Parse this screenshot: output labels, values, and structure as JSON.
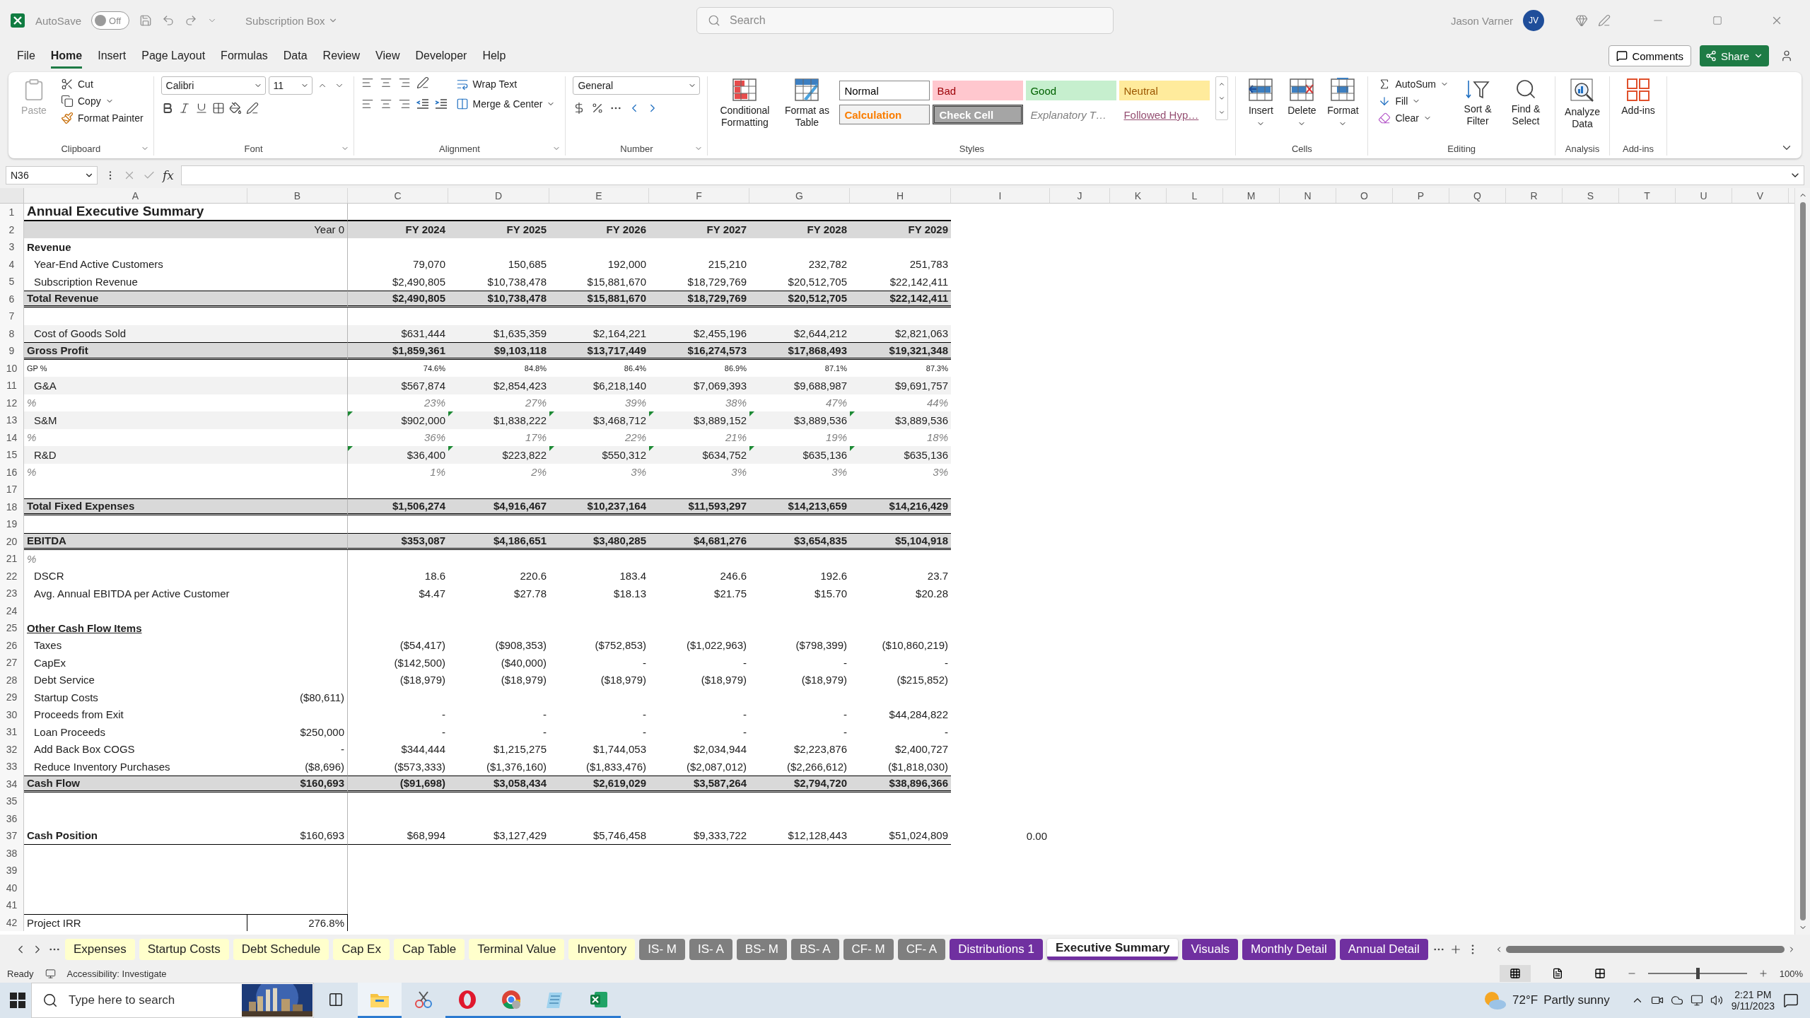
{
  "titlebar": {
    "autosave_label": "AutoSave",
    "autosave_state": "Off",
    "autosave_on": false,
    "document": "Subscription Box",
    "search_placeholder": "Search",
    "user": "Jason Varner",
    "initials": "JV"
  },
  "menu": [
    {
      "label": "File",
      "selected": false
    },
    {
      "label": "Home",
      "selected": true
    },
    {
      "label": "Insert",
      "selected": false
    },
    {
      "label": "Page Layout",
      "selected": false
    },
    {
      "label": "Formulas",
      "selected": false
    },
    {
      "label": "Data",
      "selected": false
    },
    {
      "label": "Review",
      "selected": false
    },
    {
      "label": "View",
      "selected": false
    },
    {
      "label": "Developer",
      "selected": false
    },
    {
      "label": "Help",
      "selected": false
    }
  ],
  "actions": {
    "comments": "Comments",
    "share": "Share"
  },
  "ribbon": {
    "clipboard": {
      "label": "Clipboard",
      "paste": "Paste",
      "paste_disabled": true,
      "cut": "Cut",
      "copy": "Copy",
      "painter": "Format Painter"
    },
    "font": {
      "label": "Font",
      "name": "Calibri",
      "size": "11"
    },
    "alignment": {
      "label": "Alignment",
      "wrap": "Wrap Text",
      "merge": "Merge & Center"
    },
    "number": {
      "label": "Number",
      "format": "General"
    },
    "styles": {
      "label": "Styles",
      "conditional": "Conditional Formatting",
      "table": "Format as Table",
      "cells": [
        {
          "name": "Normal",
          "kind": "normal"
        },
        {
          "name": "Bad",
          "kind": "bad"
        },
        {
          "name": "Good",
          "kind": "good"
        },
        {
          "name": "Neutral",
          "kind": "neutral"
        },
        {
          "name": "Calculation",
          "kind": "calculation"
        },
        {
          "name": "Check Cell",
          "kind": "check"
        },
        {
          "name": "Explanatory T…",
          "kind": "explanatory"
        },
        {
          "name": "Followed Hyp…",
          "kind": "hyperlink"
        }
      ]
    },
    "cells": {
      "label": "Cells",
      "buttons": [
        {
          "label": "Insert",
          "kind": "insert"
        },
        {
          "label": "Delete",
          "kind": "delete"
        },
        {
          "label": "Format",
          "kind": "format"
        }
      ]
    },
    "editing": {
      "label": "Editing",
      "autosum": "AutoSum",
      "fill": "Fill",
      "clear": "Clear",
      "sort": "Sort & Filter",
      "find": "Find & Select"
    },
    "analysis": {
      "label": "Analysis",
      "analyze": "Analyze Data"
    },
    "addins": {
      "label": "Add-ins",
      "button": "Add-ins"
    }
  },
  "formula_bar": {
    "name_box": "N36",
    "function_label": "fx"
  },
  "columns": [
    "A",
    "B",
    "C",
    "D",
    "E",
    "F",
    "G",
    "H",
    "I",
    "J",
    "K",
    "L",
    "M",
    "N",
    "O",
    "P",
    "Q",
    "R",
    "S",
    "T",
    "U",
    "V"
  ],
  "rows": [
    {
      "n": "1",
      "kind": "title",
      "label": "Annual Executive Summary"
    },
    {
      "n": "2",
      "kind": "header",
      "b": "Year 0",
      "values": [
        "FY 2024",
        "FY 2025",
        "FY 2026",
        "FY 2027",
        "FY 2028",
        "FY 2029"
      ]
    },
    {
      "n": "3",
      "kind": "section",
      "label": "Revenue"
    },
    {
      "n": "4",
      "kind": "item",
      "label": "Year-End Active Customers",
      "values": [
        "79,070",
        "150,685",
        "192,000",
        "215,210",
        "232,782",
        "251,783"
      ]
    },
    {
      "n": "5",
      "kind": "item",
      "label": "Subscription Revenue",
      "values": [
        "$2,490,805",
        "$10,738,478",
        "$15,881,670",
        "$18,729,769",
        "$20,512,705",
        "$22,142,411"
      ]
    },
    {
      "n": "6",
      "kind": "total",
      "label": "Total Revenue",
      "values": [
        "$2,490,805",
        "$10,738,478",
        "$15,881,670",
        "$18,729,769",
        "$20,512,705",
        "$22,142,411"
      ]
    },
    {
      "n": "7",
      "kind": "blank"
    },
    {
      "n": "8",
      "kind": "item",
      "shaded": true,
      "label": "Cost of Goods Sold",
      "values": [
        "$631,444",
        "$1,635,359",
        "$2,164,221",
        "$2,455,196",
        "$2,644,212",
        "$2,821,063"
      ]
    },
    {
      "n": "9",
      "kind": "total",
      "label": "Gross Profit",
      "values": [
        "$1,859,361",
        "$9,103,118",
        "$13,717,449",
        "$16,274,573",
        "$17,868,493",
        "$19,321,348"
      ]
    },
    {
      "n": "10",
      "kind": "small",
      "label": "GP %",
      "values": [
        "74.6%",
        "84.8%",
        "86.4%",
        "86.9%",
        "87.1%",
        "87.3%"
      ]
    },
    {
      "n": "11",
      "kind": "item",
      "shaded": true,
      "label": "G&A",
      "values": [
        "$567,874",
        "$2,854,423",
        "$6,218,140",
        "$7,069,393",
        "$9,688,987",
        "$9,691,757"
      ]
    },
    {
      "n": "12",
      "kind": "pct",
      "label": "%",
      "values": [
        "23%",
        "27%",
        "39%",
        "38%",
        "47%",
        "44%"
      ]
    },
    {
      "n": "13",
      "kind": "item",
      "shaded": true,
      "flagged": true,
      "label": "S&M",
      "values": [
        "$902,000",
        "$1,838,222",
        "$3,468,712",
        "$3,889,152",
        "$3,889,536",
        "$3,889,536"
      ]
    },
    {
      "n": "14",
      "kind": "pct",
      "label": "%",
      "values": [
        "36%",
        "17%",
        "22%",
        "21%",
        "19%",
        "18%"
      ]
    },
    {
      "n": "15",
      "kind": "item",
      "shaded": true,
      "flagged": true,
      "label": "R&D",
      "values": [
        "$36,400",
        "$223,822",
        "$550,312",
        "$634,752",
        "$635,136",
        "$635,136"
      ]
    },
    {
      "n": "16",
      "kind": "pct",
      "label": "%",
      "values": [
        "1%",
        "2%",
        "3%",
        "3%",
        "3%",
        "3%"
      ]
    },
    {
      "n": "17",
      "kind": "blank"
    },
    {
      "n": "18",
      "kind": "total",
      "label": "Total Fixed Expenses",
      "values": [
        "$1,506,274",
        "$4,916,467",
        "$10,237,164",
        "$11,593,297",
        "$14,213,659",
        "$14,216,429"
      ]
    },
    {
      "n": "19",
      "kind": "blank"
    },
    {
      "n": "20",
      "kind": "total",
      "label": "EBITDA",
      "values": [
        "$353,087",
        "$4,186,651",
        "$3,480,285",
        "$4,681,276",
        "$3,654,835",
        "$5,104,918"
      ]
    },
    {
      "n": "21",
      "kind": "pct",
      "label": "%"
    },
    {
      "n": "22",
      "kind": "item",
      "label": "DSCR",
      "values": [
        "18.6",
        "220.6",
        "183.4",
        "246.6",
        "192.6",
        "23.7"
      ]
    },
    {
      "n": "23",
      "kind": "item",
      "label": "Avg. Annual EBITDA per Active Customer",
      "values": [
        "$4.47",
        "$27.78",
        "$18.13",
        "$21.75",
        "$15.70",
        "$20.28"
      ]
    },
    {
      "n": "24",
      "kind": "blank"
    },
    {
      "n": "25",
      "kind": "heading",
      "label": "Other Cash Flow Items"
    },
    {
      "n": "26",
      "kind": "item",
      "label": "Taxes",
      "values": [
        "($54,417)",
        "($908,353)",
        "($752,853)",
        "($1,022,963)",
        "($798,399)",
        "($10,860,219)"
      ]
    },
    {
      "n": "27",
      "kind": "item",
      "label": "CapEx",
      "values": [
        "($142,500)",
        "($40,000)",
        "-",
        "-",
        "-",
        "-"
      ]
    },
    {
      "n": "28",
      "kind": "item",
      "label": "Debt Service",
      "values": [
        "($18,979)",
        "($18,979)",
        "($18,979)",
        "($18,979)",
        "($18,979)",
        "($215,852)"
      ]
    },
    {
      "n": "29",
      "kind": "item",
      "label": "Startup Costs",
      "b": "($80,611)"
    },
    {
      "n": "30",
      "kind": "item",
      "label": "Proceeds from Exit",
      "values": [
        "-",
        "-",
        "-",
        "-",
        "-",
        "$44,284,822"
      ]
    },
    {
      "n": "31",
      "kind": "item",
      "label": "Loan Proceeds",
      "b": "$250,000",
      "values": [
        "-",
        "-",
        "-",
        "-",
        "-",
        "-"
      ]
    },
    {
      "n": "32",
      "kind": "item",
      "label": "Add Back Box COGS",
      "b": "-",
      "values": [
        "$344,444",
        "$1,215,275",
        "$1,744,053",
        "$2,034,944",
        "$2,223,876",
        "$2,400,727"
      ]
    },
    {
      "n": "33",
      "kind": "item",
      "label": "Reduce Inventory Purchases",
      "b": "($8,696)",
      "values": [
        "($573,333)",
        "($1,376,160)",
        "($1,833,476)",
        "($2,087,012)",
        "($2,266,612)",
        "($1,818,030)"
      ]
    },
    {
      "n": "34",
      "kind": "total",
      "label": "Cash Flow",
      "b": "$160,693",
      "values": [
        "($91,698)",
        "$3,058,434",
        "$2,619,029",
        "$3,587,264",
        "$2,794,720",
        "$38,896,366"
      ]
    },
    {
      "n": "35",
      "kind": "blank"
    },
    {
      "n": "36",
      "kind": "blank"
    },
    {
      "n": "37",
      "kind": "position",
      "label": "Cash Position",
      "b": "$160,693",
      "values": [
        "$68,994",
        "$3,127,429",
        "$5,746,458",
        "$9,333,722",
        "$12,128,443",
        "$51,024,809",
        "0.00"
      ]
    },
    {
      "n": "38",
      "kind": "blank"
    },
    {
      "n": "39",
      "kind": "blank"
    },
    {
      "n": "40",
      "kind": "blank"
    },
    {
      "n": "41",
      "kind": "blank"
    },
    {
      "n": "42",
      "kind": "irr",
      "label": "Project IRR",
      "b": "276.8%"
    }
  ],
  "sheet_tabs": [
    {
      "label": "Expenses",
      "color": "#ffffcc",
      "selected": false
    },
    {
      "label": "Startup Costs",
      "color": "#ffffcc",
      "selected": false
    },
    {
      "label": "Debt Schedule",
      "color": "#ffffcc",
      "selected": false
    },
    {
      "label": "Cap Ex",
      "color": "#ffffcc",
      "selected": false
    },
    {
      "label": "Cap Table",
      "color": "#ffffcc",
      "selected": false
    },
    {
      "label": "Terminal Value",
      "color": "#ffffcc",
      "selected": false
    },
    {
      "label": "Inventory",
      "color": "#ffffcc",
      "selected": false
    },
    {
      "label": "IS- M",
      "color": "#7f7f7f",
      "selected": false
    },
    {
      "label": "IS- A",
      "color": "#7f7f7f",
      "selected": false
    },
    {
      "label": "BS- M",
      "color": "#7f7f7f",
      "selected": false
    },
    {
      "label": "BS- A",
      "color": "#7f7f7f",
      "selected": false
    },
    {
      "label": "CF- M",
      "color": "#7f7f7f",
      "selected": false
    },
    {
      "label": "CF- A",
      "color": "#7f7f7f",
      "selected": false
    },
    {
      "label": "Distributions 1",
      "color": "#7030a0",
      "selected": false
    },
    {
      "label": "Executive Summary",
      "color": "#7030a0",
      "selected": true
    },
    {
      "label": "Visuals",
      "color": "#7030a0",
      "selected": false
    },
    {
      "label": "Monthly Detail",
      "color": "#7030a0",
      "selected": false
    },
    {
      "label": "Annual Detail",
      "color": "#7030a0",
      "selected": false
    }
  ],
  "status_bar": {
    "ready": "Ready",
    "accessibility": "Accessibility: Investigate",
    "zoom": {
      "level": 0.5,
      "reading": "100%"
    }
  },
  "taskbar": {
    "search_placeholder": "Type here to search",
    "apps": [
      {
        "kind": "files",
        "running": true,
        "selected": true
      },
      {
        "kind": "snipping",
        "running": false,
        "selected": false
      },
      {
        "kind": "opera",
        "running": true,
        "selected": false
      },
      {
        "kind": "chrome",
        "running": true,
        "selected": false
      },
      {
        "kind": "notepad",
        "running": true,
        "selected": false
      },
      {
        "kind": "excel",
        "running": true,
        "selected": false
      }
    ],
    "temperature": "72°F",
    "weather": "Partly sunny",
    "time": "2:21 PM",
    "date": "9/11/2023"
  }
}
